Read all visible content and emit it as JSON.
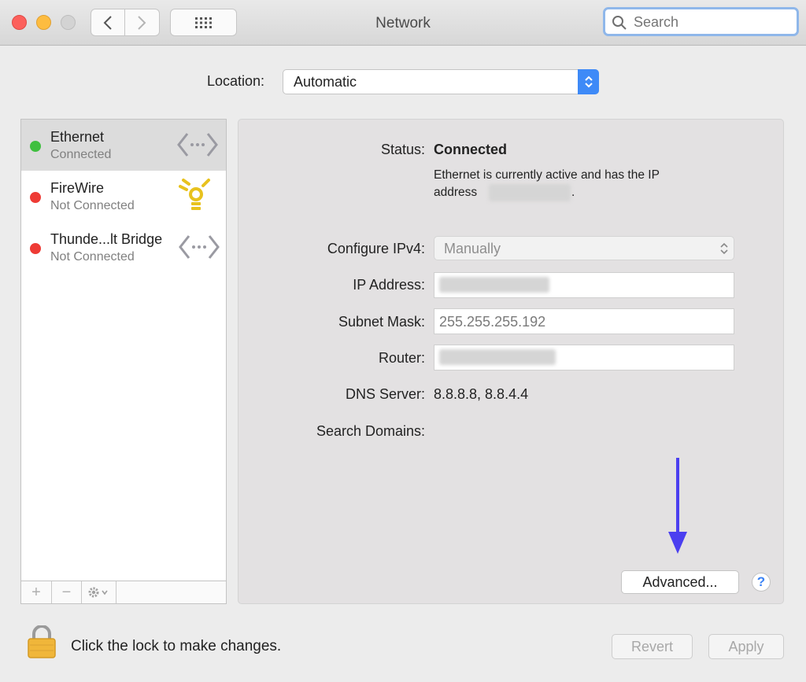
{
  "window": {
    "title": "Network"
  },
  "toolbar": {
    "search_placeholder": "Search"
  },
  "location": {
    "label": "Location:",
    "value": "Automatic"
  },
  "sidebar": {
    "services": [
      {
        "name": "Ethernet",
        "status": "Connected",
        "status_color": "#3fbf3f",
        "icon": "ethernet-arrows-icon",
        "selected": true
      },
      {
        "name": "FireWire",
        "status": "Not Connected",
        "status_color": "#ee3b35",
        "icon": "firewire-icon",
        "selected": false
      },
      {
        "name": "Thunde...lt Bridge",
        "status": "Not Connected",
        "status_color": "#ee3b35",
        "icon": "ethernet-arrows-icon",
        "selected": false
      }
    ],
    "toolbar": {
      "add": "+",
      "remove": "−",
      "action": "gear-menu-icon"
    }
  },
  "detail": {
    "status_label": "Status:",
    "status_value": "Connected",
    "status_desc_line1": "Ethernet is currently active and has the IP",
    "status_desc_line2": "address",
    "configure_label": "Configure IPv4:",
    "configure_value": "Manually",
    "ip_label": "IP Address:",
    "subnet_label": "Subnet Mask:",
    "subnet_value": "255.255.255.192",
    "router_label": "Router:",
    "dns_label": "DNS Server:",
    "dns_value": "8.8.8.8, 8.8.4.4",
    "search_domains_label": "Search Domains:",
    "advanced_label": "Advanced...",
    "help_label": "?"
  },
  "footer": {
    "lock_text": "Click the lock to make changes.",
    "revert_label": "Revert",
    "apply_label": "Apply"
  },
  "colors": {
    "accent": "#3e8af7",
    "annotation_arrow": "#4b3ff0"
  }
}
